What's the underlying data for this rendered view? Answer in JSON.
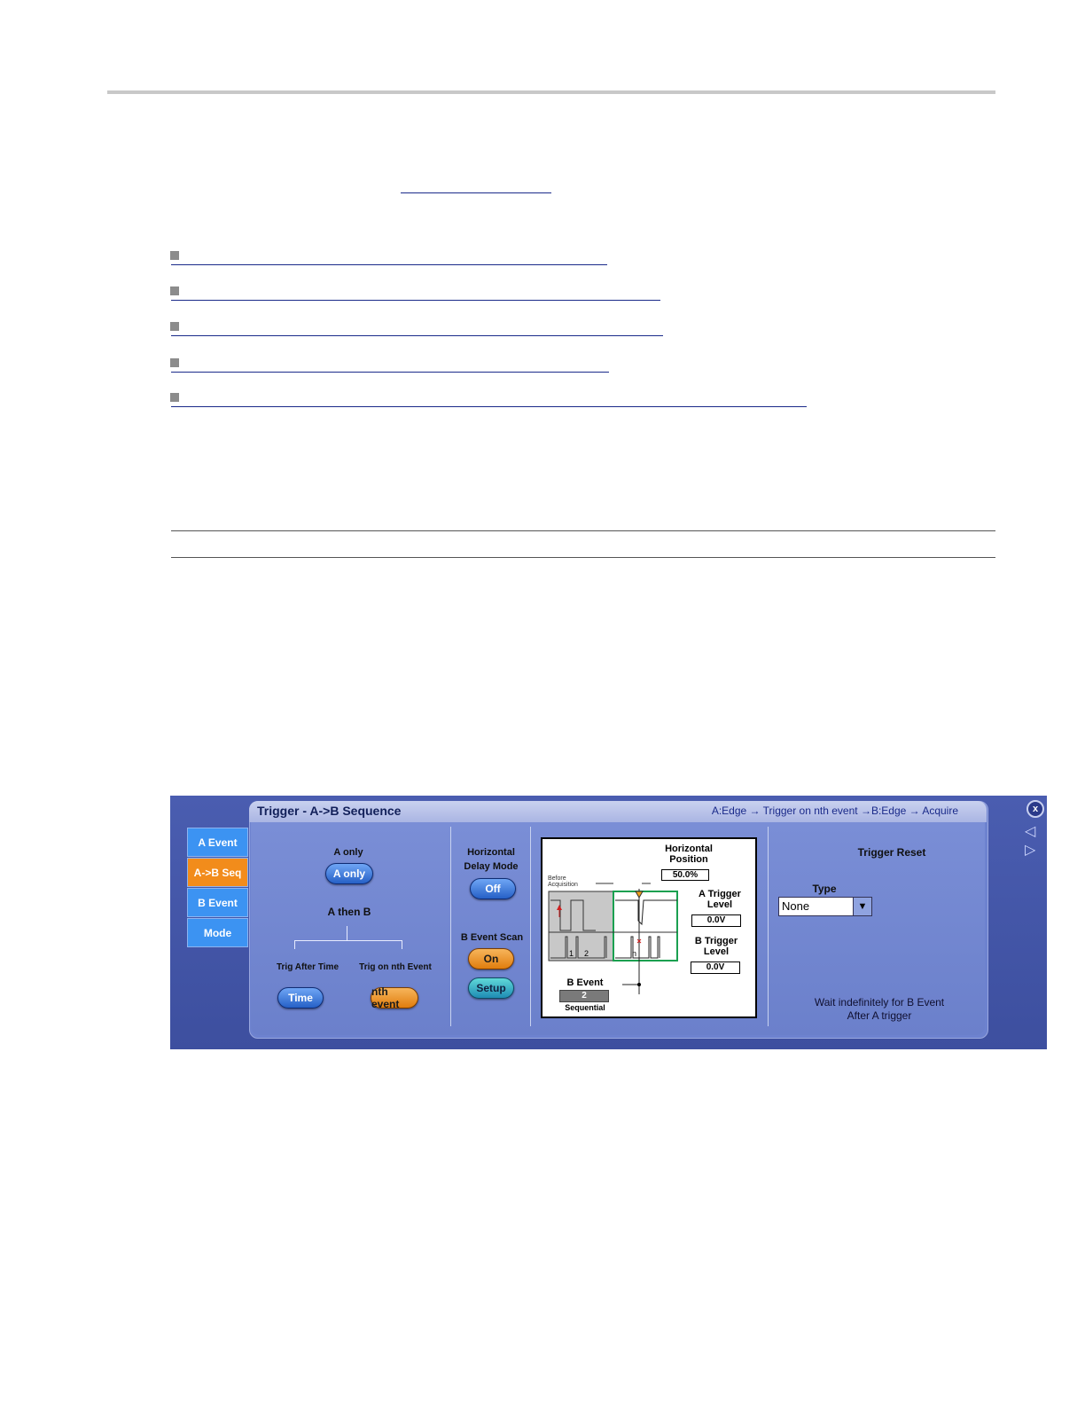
{
  "panel": {
    "title": "Trigger - A->B Sequence",
    "breadcrumb": "A:Edge → Trigger on nth event →B:Edge → Acquire",
    "close_label": "x",
    "tabs": [
      "A Event",
      "A->B Seq",
      "B Event",
      "Mode"
    ],
    "a_only_label": "A only",
    "a_only_button": "A only",
    "a_then_b_label": "A then B",
    "trig_after_time_label": "Trig After Time",
    "trig_nth_label": "Trig on nth Event",
    "time_button": "Time",
    "nth_button": "nth event",
    "horizontal_delay_label_1": "Horizontal",
    "horizontal_delay_label_2": "Delay Mode",
    "delay_button": "Off",
    "b_event_scan_label": "B Event Scan",
    "scan_on_button": "On",
    "setup_button": "Setup",
    "diagram": {
      "horizontal_position_label_1": "Horizontal",
      "horizontal_position_label_2": "Position",
      "horizontal_position_value": "50.0%",
      "before_acquisition": "Before Acquisition",
      "a_trigger_label_1": "A Trigger",
      "a_trigger_label_2": "Level",
      "a_trigger_value": "0.0V",
      "b_trigger_label_1": "B Trigger",
      "b_trigger_label_2": "Level",
      "b_trigger_value": "0.0V",
      "b_event_label": "B Event",
      "b_event_value": "2",
      "sequential_label": "Sequential",
      "pulse_labels": [
        "1",
        "2",
        "n"
      ]
    },
    "trigger_reset_label": "Trigger Reset",
    "type_label": "Type",
    "type_value": "None",
    "status_line_1": "Wait indefinitely for B Event",
    "status_line_2": "After A trigger"
  },
  "colors": {
    "panel_bg": "#6d82cf",
    "tab_blue": "#3c93f2",
    "tab_active": "#f28c1b"
  }
}
